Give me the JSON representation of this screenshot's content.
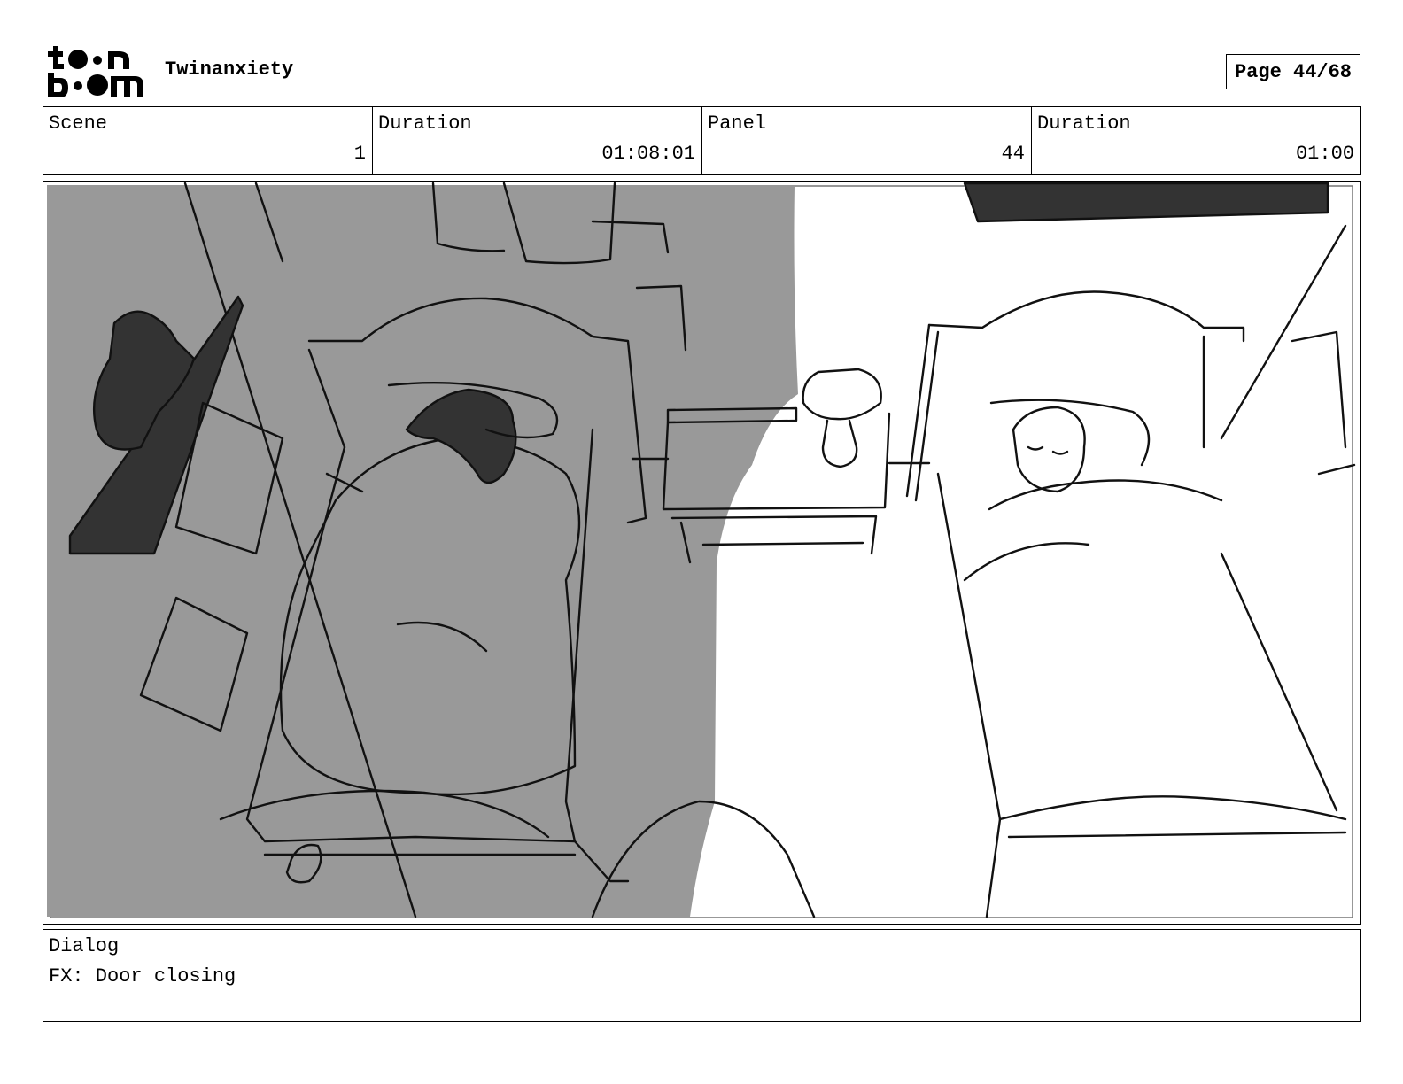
{
  "header": {
    "logo_text_top": "toon",
    "logo_text_bottom": "boom",
    "project_title": "Twinanxiety",
    "page_label": "Page 44/68"
  },
  "info": {
    "scene_label": "Scene",
    "scene_value": "1",
    "scene_duration_label": "Duration",
    "scene_duration_value": "01:08:01",
    "panel_label": "Panel",
    "panel_value": "44",
    "panel_duration_label": "Duration",
    "panel_duration_value": "01:00"
  },
  "panel_image": {
    "icon": "storyboard-sketch",
    "shade_color": "#999999",
    "dark_color": "#333333"
  },
  "dialog": {
    "label": "Dialog",
    "text": "FX: Door closing"
  }
}
